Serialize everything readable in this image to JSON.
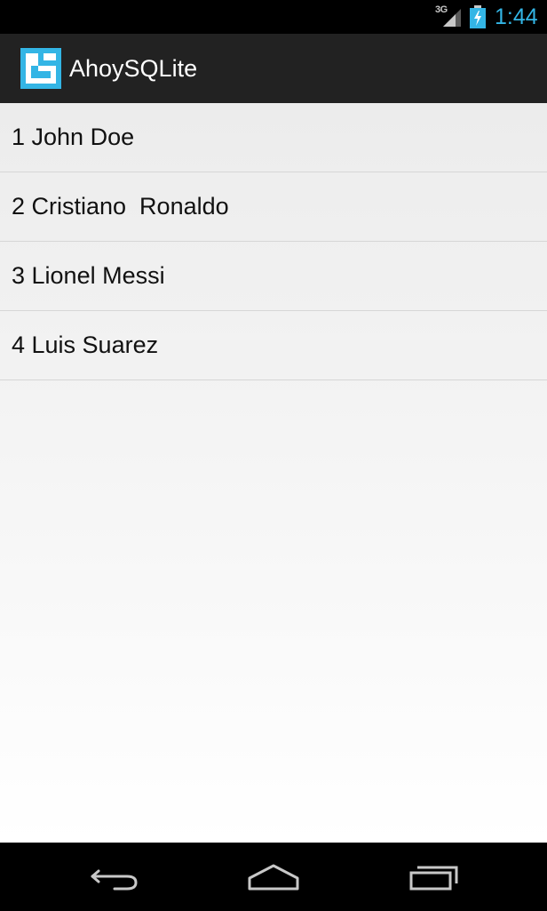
{
  "status_bar": {
    "network": "3G",
    "time": "1:44",
    "signal_icon": "signal-icon",
    "battery_icon": "battery-charging-icon",
    "accent_color": "#33b5e5"
  },
  "action_bar": {
    "title": "AhoySQLite",
    "icon": "app-logo-icon",
    "icon_color": "#33b5e5"
  },
  "list": {
    "items": [
      {
        "label": "1 John Doe"
      },
      {
        "label": "2 Cristiano  Ronaldo"
      },
      {
        "label": "3 Lionel Messi"
      },
      {
        "label": "4 Luis Suarez"
      }
    ]
  },
  "nav_bar": {
    "back_icon": "back-icon",
    "home_icon": "home-icon",
    "recents_icon": "recents-icon"
  }
}
